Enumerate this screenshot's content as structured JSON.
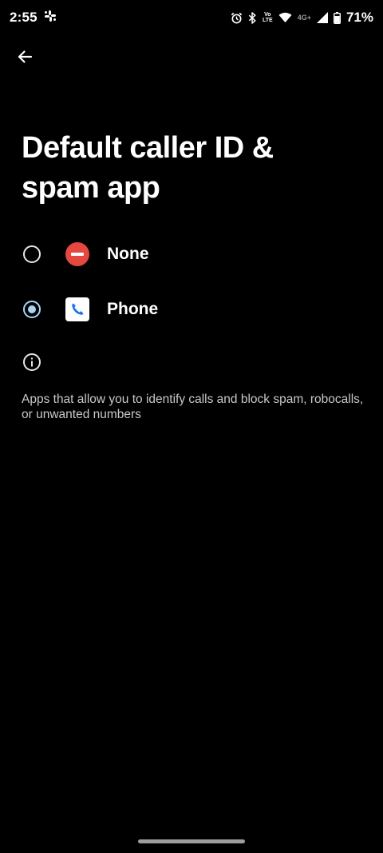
{
  "status_bar": {
    "time": "2:55",
    "volte_top": "Vo",
    "volte_bottom": "LTE",
    "network_type": "4G+",
    "battery_percent": "71%",
    "icons": [
      "slack-icon",
      "alarm-icon",
      "bluetooth-icon",
      "volte-icon",
      "wifi-icon",
      "signal-icon",
      "battery-icon"
    ]
  },
  "header": {
    "back_icon": "arrow-back-icon",
    "title": "Default caller ID & spam app"
  },
  "options": [
    {
      "label": "None",
      "icon": "none-icon",
      "selected": false
    },
    {
      "label": "Phone",
      "icon": "phone-app-icon",
      "selected": true
    }
  ],
  "footer": {
    "info_icon": "info-icon",
    "text": "Apps that allow you to identify calls and block spam, robocalls, or unwanted numbers"
  },
  "colors": {
    "background": "#000000",
    "radio_selected": "#a8d4f5",
    "none_icon": "#e5483f",
    "phone_icon_blue": "#1a73e8"
  }
}
